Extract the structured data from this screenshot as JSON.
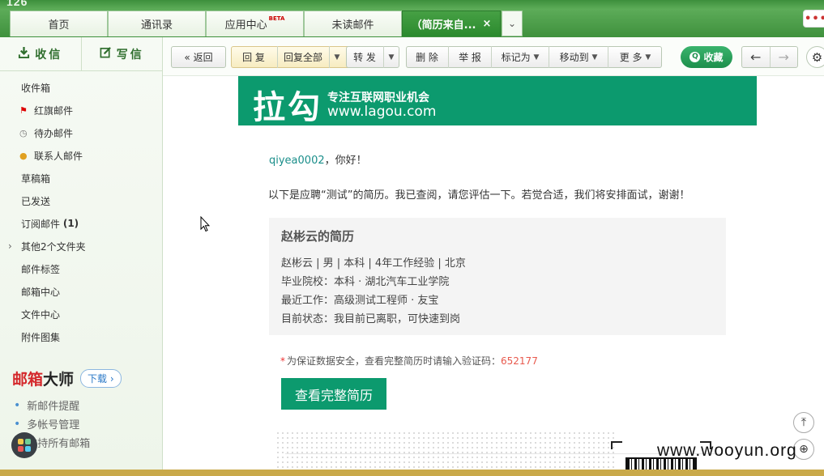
{
  "brand_top": "126",
  "tabs": [
    {
      "label": "首页"
    },
    {
      "label": "通讯录"
    },
    {
      "label": "应用中心",
      "badge": "BETA"
    },
    {
      "label": "未读邮件"
    },
    {
      "label": "（简历来自...",
      "close": "×"
    }
  ],
  "tab_dropdown": "⌄",
  "more_dots": "•••",
  "sidebar": {
    "receive": "收信",
    "compose": "写信",
    "folders": [
      {
        "label": "收件箱",
        "icon": ""
      },
      {
        "label": "红旗邮件",
        "icon": "flag-icon"
      },
      {
        "label": "待办邮件",
        "icon": "clock-icon"
      },
      {
        "label": "联系人邮件",
        "icon": "contact-icon"
      },
      {
        "label": "草稿箱",
        "icon": ""
      },
      {
        "label": "已发送",
        "icon": ""
      },
      {
        "label": "订阅邮件",
        "count": "(1)"
      },
      {
        "label": "其他2个文件夹",
        "expandable": true
      },
      {
        "label": "邮件标签"
      },
      {
        "label": "邮箱中心"
      },
      {
        "label": "文件中心"
      },
      {
        "label": "附件图集"
      }
    ],
    "promo": {
      "title_part1": "邮箱",
      "title_part2": "大师",
      "download": "下载",
      "features": [
        "新邮件提醒",
        "多帐号管理",
        "支持所有邮箱"
      ]
    }
  },
  "toolbar": {
    "back": "返回",
    "reply": "回 复",
    "reply_all": "回复全部",
    "forward": "转 发",
    "delete": "删 除",
    "report": "举 报",
    "mark_as": "标记为",
    "move_to": "移动到",
    "more": "更 多",
    "collect": "收藏"
  },
  "mail": {
    "banner": {
      "logo": "拉勾",
      "slogan": "专注互联网职业机会",
      "url": "www.lagou.com"
    },
    "greeting_user": "qiyea0002",
    "greeting_text": "，你好！",
    "intro": "以下是应聘“测试”的简历。我已查阅，请您评估一下。若觉合适，我们将安排面试，谢谢！",
    "card": {
      "name": "赵彬云的简历",
      "summary": "赵彬云 | 男 | 本科 | 4年工作经验 | 北京",
      "school": "毕业院校：本科 · 湖北汽车工业学院",
      "recent_job": "最近工作：高级测试工程师 · 友宝",
      "status": "目前状态：我目前已离职，可快速到岗"
    },
    "verify_star": "*",
    "verify_text": "为保证数据安全，查看完整简历时请输入验证码：",
    "verify_code": "652177",
    "view_button": "查看完整简历"
  },
  "watermark": "www.wooyun.org",
  "colors": {
    "lagou_green": "#0c9a6e",
    "tab_active": "#2b8a2e",
    "code_red": "#e8594d"
  }
}
